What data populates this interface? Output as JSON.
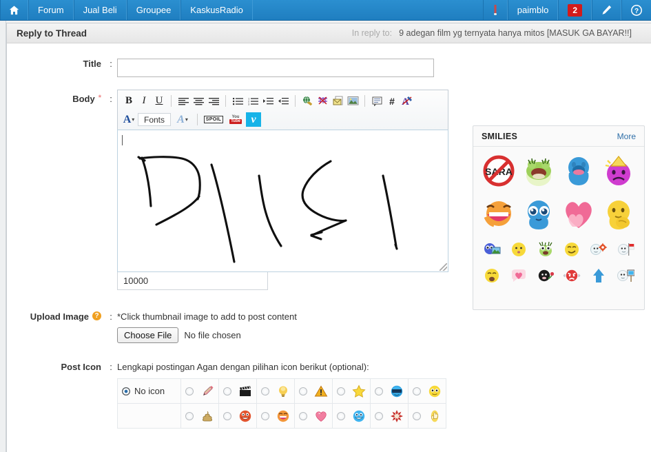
{
  "nav": {
    "left": [
      {
        "label": "",
        "icon": "home-icon",
        "name": "nav-home"
      },
      {
        "label": "Forum",
        "icon": "",
        "name": "nav-forum"
      },
      {
        "label": "Jual Beli",
        "icon": "",
        "name": "nav-jual-beli"
      },
      {
        "label": "Groupee",
        "icon": "",
        "name": "nav-groupee"
      },
      {
        "label": "KaskusRadio",
        "icon": "",
        "name": "nav-kaskusradio"
      }
    ],
    "right": {
      "user_icon": "user-icon",
      "username": "paimblo",
      "notification_count": "2",
      "compose_icon": "pencil-icon",
      "help_icon": "question-icon"
    }
  },
  "panel": {
    "title": "Reply to Thread",
    "in_reply_to_label": "In reply to:",
    "thread_title": "9 adegan film yg ternyata hanya mitos [MASUK GA BAYAR!!]"
  },
  "form": {
    "title_label": "Title",
    "title_value": "",
    "title_placeholder": "",
    "body_label": "Body",
    "body_required_mark": "*",
    "colon": ":",
    "char_count": "10000",
    "upload_label": "Upload Image",
    "upload_hint": "*Click thumbnail image to add to post content",
    "choose_file_label": "Choose File",
    "no_file_label": "No file chosen",
    "post_icon_label": "Post Icon",
    "post_icon_hint": "Lengkapi postingan Agan dengan pilihan icon berikut (optional):",
    "no_icon_label": "No icon"
  },
  "toolbar": {
    "row1": [
      {
        "name": "bold-icon",
        "glyph": "B"
      },
      {
        "name": "italic-icon",
        "glyph": "I"
      },
      {
        "name": "underline-icon",
        "glyph": "U"
      },
      {
        "name": "align-left-icon",
        "glyph": ""
      },
      {
        "name": "align-center-icon",
        "glyph": ""
      },
      {
        "name": "align-right-icon",
        "glyph": ""
      },
      {
        "name": "bullet-list-icon",
        "glyph": ""
      },
      {
        "name": "numbered-list-icon",
        "glyph": ""
      },
      {
        "name": "indent-increase-icon",
        "glyph": ""
      },
      {
        "name": "indent-decrease-icon",
        "glyph": ""
      },
      {
        "name": "insert-link-icon",
        "glyph": ""
      },
      {
        "name": "remove-link-icon",
        "glyph": ""
      },
      {
        "name": "insert-email-icon",
        "glyph": ""
      },
      {
        "name": "insert-image-icon",
        "glyph": ""
      },
      {
        "name": "quote-icon",
        "glyph": ""
      },
      {
        "name": "code-icon",
        "glyph": "#"
      },
      {
        "name": "remove-format-icon",
        "glyph": ""
      }
    ],
    "row2": {
      "font_color_icon": "font-color-icon",
      "fonts_label": "Fonts",
      "font_size_icon": "font-size-icon",
      "spoiler_label": "SPOIL",
      "youtube_top": "You",
      "youtube_bottom": "Tube",
      "vimeo_label": "v"
    }
  },
  "smilies": {
    "heading": "SMILIES",
    "more_label": "More",
    "big_row1": [
      "no-sara-icon",
      "green-frog-icon",
      "blue-blob-icon",
      "purple-party-sad-icon"
    ],
    "big_row2": [
      "orange-laugh-icon",
      "blue-teary-icon",
      "pink-heart-icon",
      "yellow-shy-icon"
    ],
    "small_row1": [
      "blue-photo-icon",
      "yellow-silent-icon",
      "green-monster-icon",
      "yellow-smirk-icon",
      "white-gear-icon",
      "white-flag-icon"
    ],
    "small_row2": [
      "yellow-shock-icon",
      "pink-heart-bubble-icon",
      "black-rose-icon",
      "red-angry-icon",
      "blue-arrow-up-icon",
      "white-sign-icon"
    ]
  },
  "post_icons": {
    "row1": [
      "pencil-icon",
      "clapperboard-icon",
      "lightbulb-icon",
      "warning-icon",
      "star-icon",
      "blue-sunglasses-icon",
      "yellow-eyes-icon"
    ],
    "row2": [
      "poop-icon",
      "red-grin-icon",
      "orange-laugh-icon",
      "pink-heart-icon",
      "blue-grin-icon",
      "red-burst-icon",
      "thumbs-up-icon"
    ]
  },
  "colors": {
    "nav_blue": "#1f7ec0",
    "badge_red": "#d21b1b",
    "accent_link": "#2f6fa8",
    "editor_border": "#bcd2e0"
  }
}
